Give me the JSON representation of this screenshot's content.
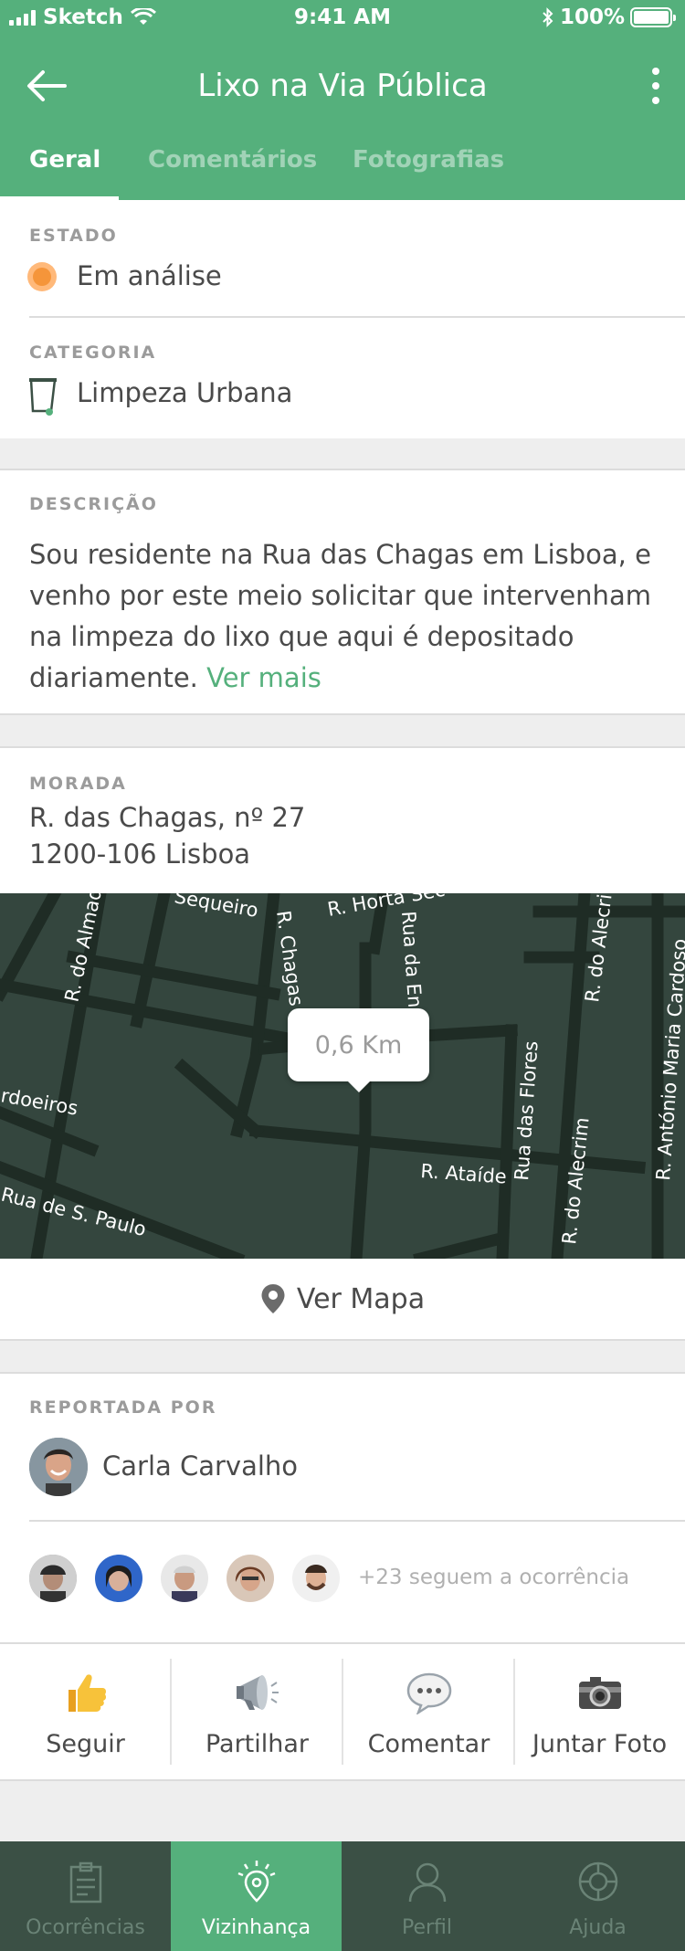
{
  "status_bar": {
    "carrier": "Sketch",
    "time": "9:41 AM",
    "battery": "100%"
  },
  "nav": {
    "title": "Lixo na Via Pública"
  },
  "tabs": [
    {
      "label": "Geral"
    },
    {
      "label": "Comentários"
    },
    {
      "label": "Fotografias"
    }
  ],
  "estado": {
    "label": "ESTADO",
    "value": "Em análise",
    "color": "#f5953a"
  },
  "categoria": {
    "label": "CATEGORIA",
    "value": "Limpeza Urbana"
  },
  "descricao": {
    "label": "DESCRIÇÃO",
    "text": "Sou residente na Rua das Chagas em Lisboa, e venho por este meio solicitar que intervenham na limpeza do lixo que aqui é depositado diariamente.",
    "more": "Ver mais"
  },
  "morada": {
    "label": "MORADA",
    "line1": "R. das Chagas, nº 27",
    "line2": "1200-106 Lisboa",
    "distance": "0,6 Km",
    "streets": [
      "R. do Almada",
      "Sequeiro",
      "R. Horta Sec",
      "R. Chagas",
      "Rua da En",
      "R. do Alecrim",
      "R. António Maria Cardoso",
      "rdoeiros",
      "Rua das Flores",
      "R. Ataíde",
      "Rua de S. Paulo",
      "R. do Alecrim"
    ],
    "map_button": "Ver Mapa"
  },
  "reportada": {
    "label": "REPORTADA POR",
    "name": "Carla Carvalho",
    "followers_text": "+23 seguem a ocorrência"
  },
  "actions": [
    {
      "label": "Seguir",
      "icon": "thumbs-up-icon"
    },
    {
      "label": "Partilhar",
      "icon": "megaphone-icon"
    },
    {
      "label": "Comentar",
      "icon": "speech-bubble-icon"
    },
    {
      "label": "Juntar Foto",
      "icon": "camera-icon"
    }
  ],
  "tabbar": [
    {
      "label": "Ocorrências",
      "icon": "clipboard-icon"
    },
    {
      "label": "Vizinhança",
      "icon": "location-pin-icon"
    },
    {
      "label": "Perfil",
      "icon": "user-icon"
    },
    {
      "label": "Ajuda",
      "icon": "lifebuoy-icon"
    }
  ],
  "colors": {
    "brand": "#55b07c",
    "tabbar": "#3b5045",
    "map": "#34463e"
  }
}
